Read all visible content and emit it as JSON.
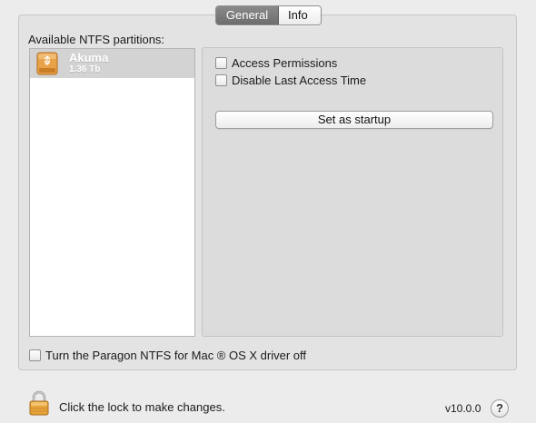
{
  "tabs": {
    "general_label": "General",
    "info_label": "Info",
    "selected": "General"
  },
  "partitions": {
    "section_label": "Available NTFS partitions:",
    "items": [
      {
        "name": "Akuma",
        "size": "1.36 Tb",
        "icon": "external-drive-icon",
        "selected": true
      }
    ]
  },
  "options": {
    "access_permissions_label": "Access Permissions",
    "access_permissions_checked": false,
    "disable_last_access_label": "Disable Last Access Time",
    "disable_last_access_checked": false,
    "set_startup_label": "Set as startup"
  },
  "driver_toggle": {
    "label": "Turn the Paragon NTFS for Mac ® OS X driver off",
    "checked": false
  },
  "footer": {
    "lock_text": "Click the lock to make changes.",
    "lock_icon": "lock-icon",
    "version": "v10.0.0",
    "help_label": "?"
  },
  "colors": {
    "selected_tab": "#7a7a7a",
    "selected_row": "#d3d3d3",
    "drive_orange": "#e89b3a"
  }
}
